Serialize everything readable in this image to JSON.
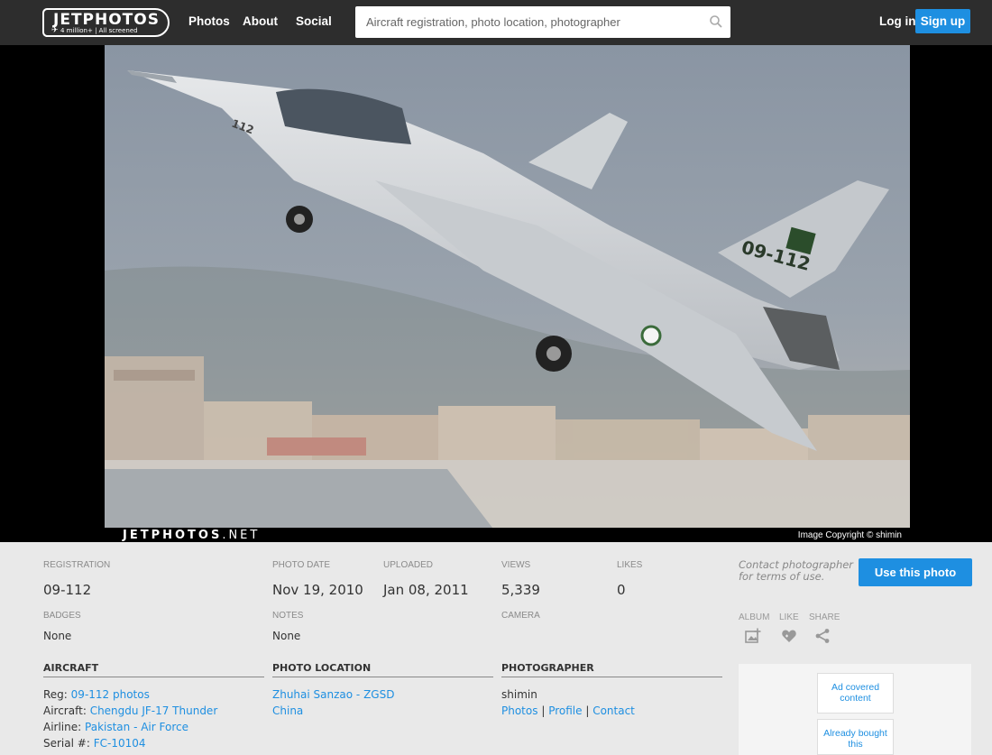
{
  "header": {
    "logo_text": "JETPHOTOS",
    "logo_tagline": "4 million+ | All screened",
    "nav": [
      "Photos",
      "About",
      "Social"
    ],
    "search_placeholder": "Aircraft registration, photo location, photographer",
    "login_label": "Log in",
    "signup_label": "Sign up"
  },
  "photo": {
    "watermark_bold": "JETPHOTOS",
    "watermark_suffix": ".NET",
    "copyright": "Image Copyright © shimin",
    "aircraft_serial_marking": "09-112",
    "nose_marking": "112"
  },
  "details": {
    "registration_label": "REGISTRATION",
    "registration": "09-112",
    "photo_date_label": "PHOTO DATE",
    "photo_date": "Nov 19, 2010",
    "uploaded_label": "UPLOADED",
    "uploaded": "Jan 08, 2011",
    "views_label": "VIEWS",
    "views": "5,339",
    "likes_label": "LIKES",
    "likes": "0",
    "badges_label": "BADGES",
    "badges": "None",
    "notes_label": "NOTES",
    "notes": "None",
    "camera_label": "CAMERA"
  },
  "aircraft": {
    "heading": "AIRCRAFT",
    "reg_label": "Reg:",
    "reg_link": "09-112 photos",
    "aircraft_label": "Aircraft:",
    "aircraft_link": "Chengdu JF-17 Thunder",
    "airline_label": "Airline:",
    "airline_link": "Pakistan - Air Force",
    "serial_label": "Serial #:",
    "serial_link": "FC-10104"
  },
  "location": {
    "heading": "PHOTO LOCATION",
    "airport_link": "Zhuhai Sanzao - ZGSD",
    "country_link": "China"
  },
  "photographer": {
    "heading": "PHOTOGRAPHER",
    "name": "shimin",
    "links": [
      "Photos",
      "Profile",
      "Contact"
    ],
    "separator": "|"
  },
  "actions": {
    "contact_text": "Contact photographer for terms of use.",
    "use_photo_label": "Use this photo",
    "album_label": "ALBUM",
    "like_label": "LIKE",
    "share_label": "SHARE",
    "icons": [
      "add-to-album-icon",
      "like-heart-icon",
      "share-icon"
    ]
  },
  "ad": {
    "covered_label": "Ad covered content",
    "bought_label": "Already bought this"
  },
  "colors": {
    "accent": "#1e8fe1",
    "topbar": "#2d2d2d",
    "page_bg": "#e9e9e9"
  }
}
